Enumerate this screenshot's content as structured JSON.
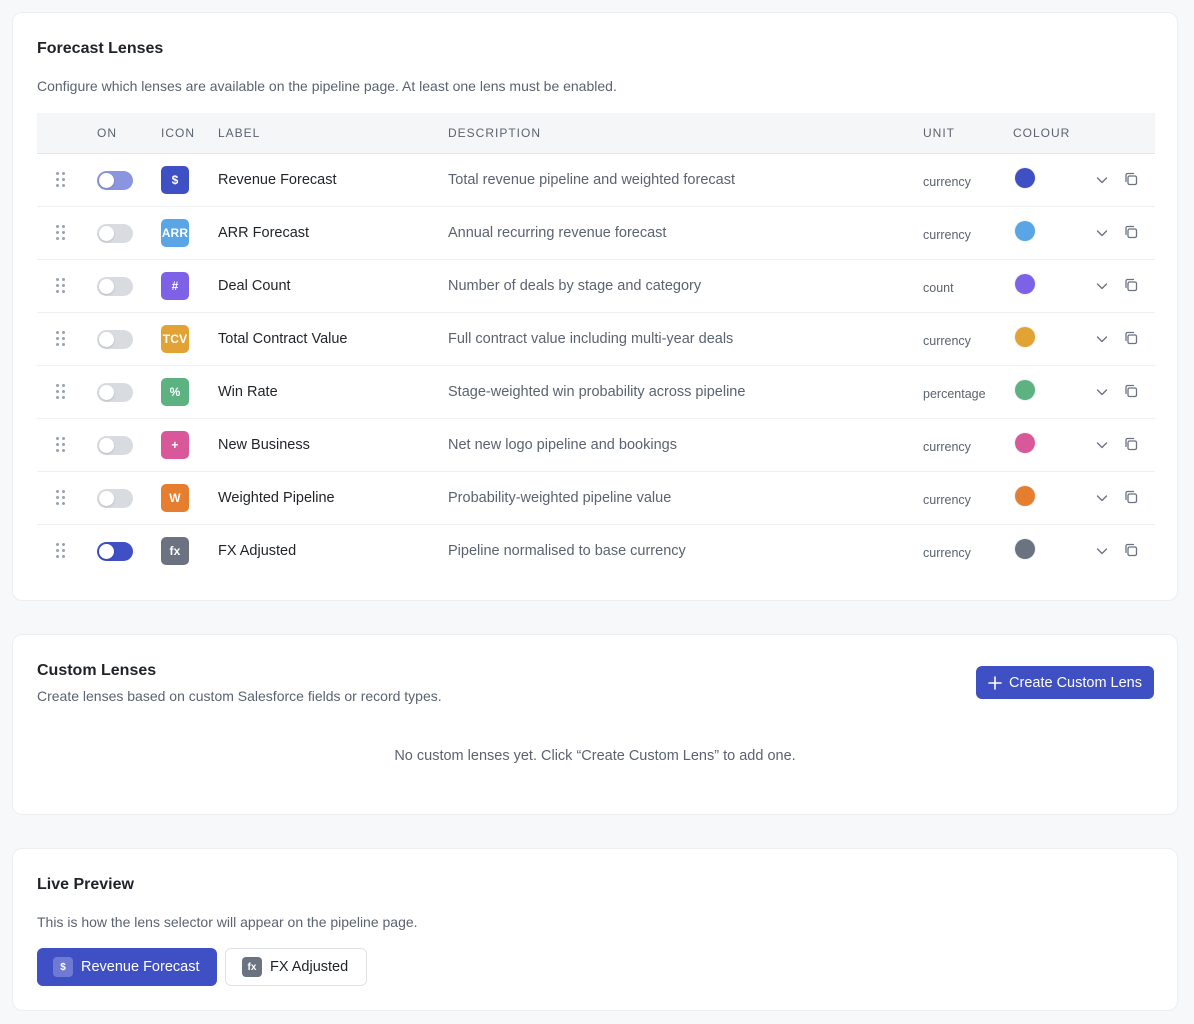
{
  "lenses_section": {
    "title": "Forecast Lenses",
    "subtitle": "Configure which lenses are available on the pipeline page. At least one lens must be enabled.",
    "columns": {
      "on": "ON",
      "icon": "ICON",
      "label": "LABEL",
      "description": "DESCRIPTION",
      "unit": "UNIT",
      "colour": "COLOUR"
    },
    "rows": [
      {
        "enabled": "partial",
        "icon_text": "$",
        "label": "Revenue Forecast",
        "description": "Total revenue pipeline and weighted forecast",
        "unit": "currency",
        "colour": "#3f4fc4"
      },
      {
        "enabled": false,
        "icon_text": "ARR",
        "label": "ARR Forecast",
        "description": "Annual recurring revenue forecast",
        "unit": "currency",
        "colour": "#5aa5e6"
      },
      {
        "enabled": false,
        "icon_text": "#",
        "label": "Deal Count",
        "description": "Number of deals by stage and category",
        "unit": "count",
        "colour": "#7d62e8"
      },
      {
        "enabled": false,
        "icon_text": "TCV",
        "label": "Total Contract Value",
        "description": "Full contract value including multi-year deals",
        "unit": "currency",
        "colour": "#e3a234"
      },
      {
        "enabled": false,
        "icon_text": "%",
        "label": "Win Rate",
        "description": "Stage-weighted win probability across pipeline",
        "unit": "percentage",
        "colour": "#5cb381"
      },
      {
        "enabled": false,
        "icon_text": "+",
        "label": "New Business",
        "description": "Net new logo pipeline and bookings",
        "unit": "currency",
        "colour": "#d9589a"
      },
      {
        "enabled": false,
        "icon_text": "W",
        "label": "Weighted Pipeline",
        "description": "Probability-weighted pipeline value",
        "unit": "currency",
        "colour": "#e57f2f"
      },
      {
        "enabled": true,
        "icon_text": "fx",
        "label": "FX Adjusted",
        "description": "Pipeline normalised to base currency",
        "unit": "currency",
        "colour": "#6b7280"
      }
    ]
  },
  "custom_section": {
    "title": "Custom Lenses",
    "subtitle": "Create lenses based on custom Salesforce fields or record types.",
    "create_button": "Create Custom Lens",
    "empty_message": "No custom lenses yet. Click “Create Custom Lens” to add one."
  },
  "preview_section": {
    "title": "Live Preview",
    "subtitle": "This is how the lens selector will appear on the pipeline page.",
    "pills": [
      {
        "icon_text": "$",
        "label": "Revenue Forecast",
        "active": true
      },
      {
        "icon_text": "fx",
        "label": "FX Adjusted",
        "active": false
      }
    ]
  },
  "theme": {
    "accent": "#3f4fc4"
  }
}
